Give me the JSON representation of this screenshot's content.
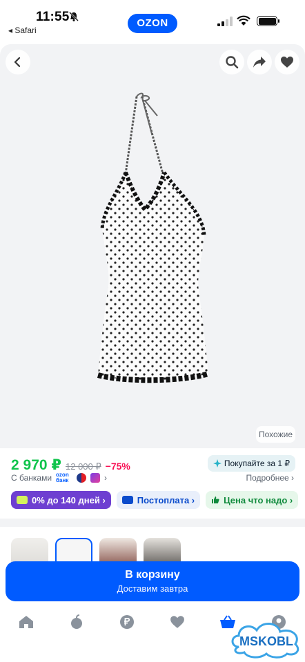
{
  "status_bar": {
    "time": "11:55",
    "back_app": "◂ Safari"
  },
  "brand": {
    "logo_text": "OZON",
    "color": "#005bff"
  },
  "gallery": {
    "similar_label": "Похожие"
  },
  "price": {
    "current": "2 970 ₽",
    "old": "12 000 ₽",
    "discount": "−75%",
    "promo": "Покупайте за 1 ₽",
    "banks_label": "С банками",
    "ozonbank_text": "ozon банк",
    "more_label": "Подробнее ›"
  },
  "chips": [
    {
      "label": "0% до 140 дней ›"
    },
    {
      "label": "Постоплата ›"
    },
    {
      "label": "Цена что надо ›"
    }
  ],
  "cart": {
    "title": "В корзину",
    "subtitle": "Доставим завтра"
  },
  "bottom_nav": {
    "items": [
      "home-icon",
      "fruit-icon",
      "ruble-icon",
      "heart-icon",
      "basket-icon",
      "profile-icon"
    ]
  },
  "watermark": {
    "text": "MSKOBL"
  },
  "colors": {
    "price_green": "#10c44c",
    "discount_red": "#f91155",
    "chip_purple": "#6e3fd1"
  }
}
